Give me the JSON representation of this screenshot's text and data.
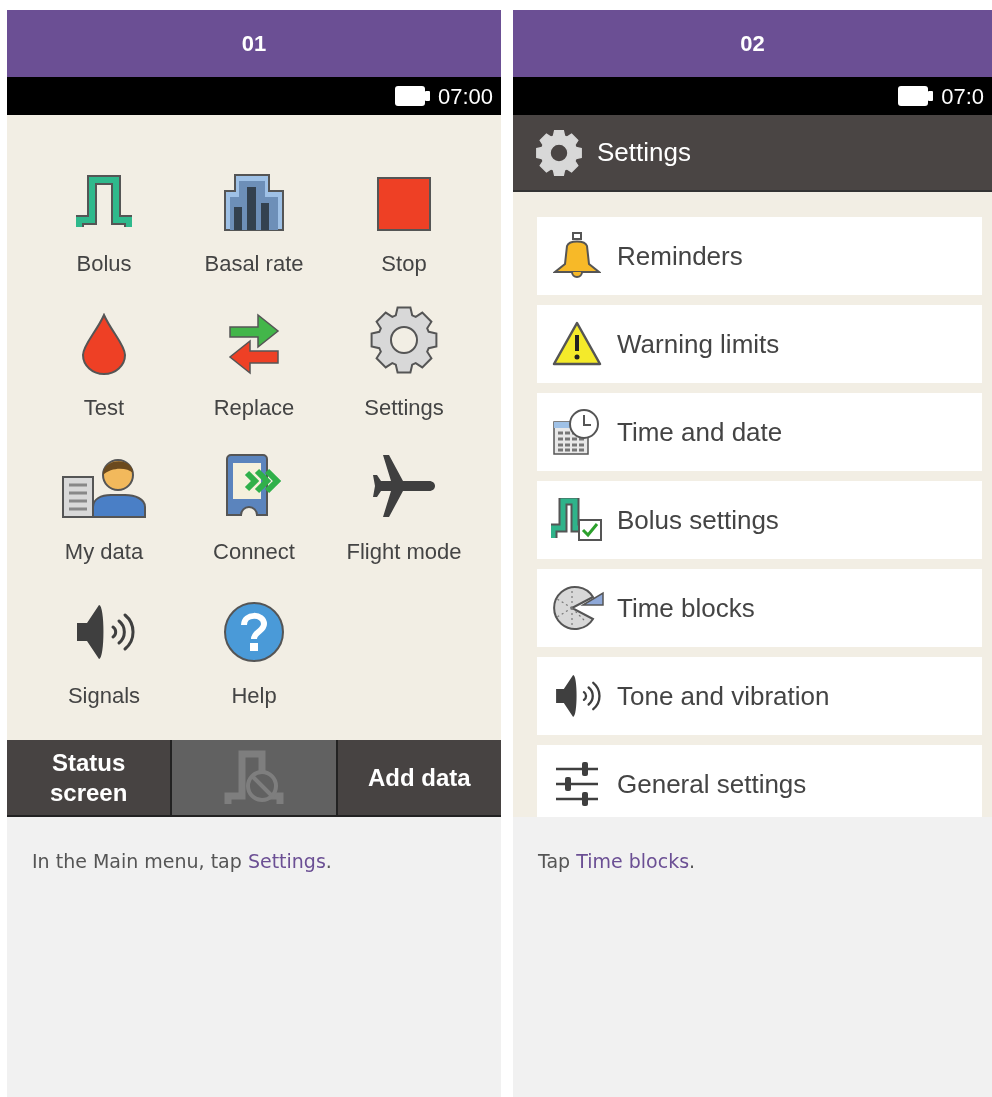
{
  "panels": [
    {
      "step": "01",
      "time": "07:00",
      "kind": "main_menu",
      "menu_items": [
        {
          "label": "Bolus"
        },
        {
          "label": "Basal rate"
        },
        {
          "label": "Stop"
        },
        {
          "label": "Test"
        },
        {
          "label": "Replace"
        },
        {
          "label": "Settings"
        },
        {
          "label": "My data"
        },
        {
          "label": "Connect"
        },
        {
          "label": "Flight mode"
        },
        {
          "label": "Signals"
        },
        {
          "label": "Help"
        }
      ],
      "bottom_bar": [
        {
          "kind": "text",
          "label": "Status screen",
          "disabled": false
        },
        {
          "kind": "icon",
          "disabled": true
        },
        {
          "kind": "text",
          "label": "Add data",
          "disabled": false
        }
      ],
      "caption": {
        "before": "In the Main menu, tap",
        "link": "Settings",
        "after": "."
      }
    },
    {
      "step": "02",
      "time": "07:0",
      "kind": "settings_menu",
      "title": "Settings",
      "list_items": [
        {
          "label": "Reminders"
        },
        {
          "label": "Warning limits"
        },
        {
          "label": "Time and date"
        },
        {
          "label": "Bolus settings"
        },
        {
          "label": "Time blocks"
        },
        {
          "label": "Tone and vibration"
        },
        {
          "label": "General settings"
        }
      ],
      "caption": {
        "before": "Tap",
        "link": "Time blocks",
        "after": "."
      }
    }
  ]
}
